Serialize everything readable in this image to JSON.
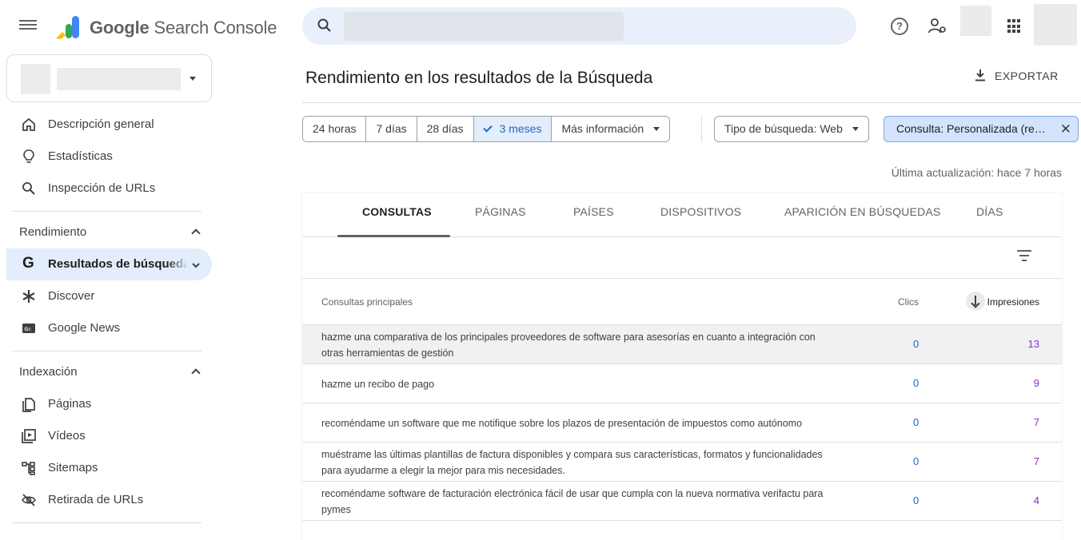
{
  "header": {
    "brand_google": "Google",
    "brand_product": "Search Console",
    "search_placeholder": ""
  },
  "sidebar": {
    "overview": "Descripción general",
    "stats": "Estadísticas",
    "inspection": "Inspección de URLs",
    "section_performance": "Rendimiento",
    "search_results": "Resultados de búsqueda",
    "discover": "Discover",
    "news": "Google News",
    "section_indexing": "Indexación",
    "pages": "Páginas",
    "videos": "Vídeos",
    "sitemaps": "Sitemaps",
    "removals": "Retirada de URLs"
  },
  "main": {
    "title": "Rendimiento en los resultados de la Búsqueda",
    "export": "EXPORTAR",
    "date_chips": [
      "24 horas",
      "7 días",
      "28 días",
      "3 meses",
      "Más información"
    ],
    "search_type": "Tipo de búsqueda: Web",
    "query_filter": "Consulta: Personalizada (re…",
    "last_update": "Última actualización: hace 7 horas"
  },
  "tabs": [
    "CONSULTAS",
    "PÁGINAS",
    "PAÍSES",
    "DISPOSITIVOS",
    "APARICIÓN EN BÚSQUEDAS",
    "DÍAS"
  ],
  "table": {
    "col_query": "Consultas principales",
    "col_clicks": "Clics",
    "col_impressions": "Impresiones",
    "rows": [
      {
        "query": "hazme una comparativa de los principales proveedores de software para asesorías en cuanto a integración con otras herramientas de gestión",
        "clicks": "0",
        "impressions": "13"
      },
      {
        "query": "hazme un recibo de pago",
        "clicks": "0",
        "impressions": "9"
      },
      {
        "query": "recoméndame un software que me notifique sobre los plazos de presentación de impuestos como autónomo",
        "clicks": "0",
        "impressions": "7"
      },
      {
        "query": "muéstrame las últimas plantillas de factura disponibles y compara sus características, formatos y funcionalidades para ayudarme a elegir la mejor para mis necesidades.",
        "clicks": "0",
        "impressions": "7"
      },
      {
        "query": "recoméndame software de facturación electrónica fácil de usar que cumpla con la nueva normativa verifactu para pymes",
        "clicks": "0",
        "impressions": "4"
      }
    ]
  },
  "colors": {
    "accent_blue": "#1967d2",
    "impressions_purple": "#8430ce",
    "selected_bg": "#e3edfb"
  }
}
